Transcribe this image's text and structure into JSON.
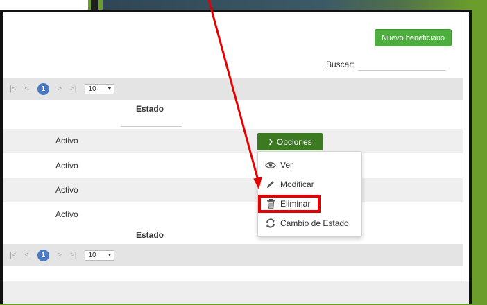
{
  "toolbar": {
    "new_label": "Nuevo beneficiario"
  },
  "search": {
    "label": "Buscar:",
    "value": ""
  },
  "pager": {
    "first": "|<",
    "prev": "<",
    "page": "1",
    "next": ">",
    "last": ">|",
    "page_size": "10"
  },
  "table": {
    "header": "Estado",
    "footer_header": "Estado",
    "rows": [
      {
        "estado": "Activo"
      },
      {
        "estado": "Activo"
      },
      {
        "estado": "Activo"
      },
      {
        "estado": "Activo"
      }
    ]
  },
  "options": {
    "button_label": "Opciones",
    "items": [
      {
        "label": "Ver",
        "icon": "eye-icon"
      },
      {
        "label": "Modificar",
        "icon": "pencil-icon"
      },
      {
        "label": "Eliminar",
        "icon": "trash-icon"
      },
      {
        "label": "Cambio de Estado",
        "icon": "refresh-icon"
      }
    ]
  },
  "colors": {
    "accent_green": "#4cae3c",
    "dark_green": "#3c7a22",
    "highlight_red": "#e60000",
    "page_blue": "#4a78c2"
  }
}
